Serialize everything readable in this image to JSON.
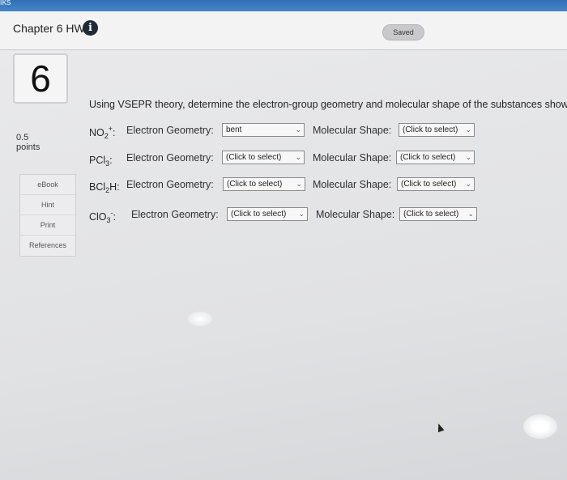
{
  "topbar": {
    "fragment": "iks"
  },
  "header": {
    "title": "Chapter 6 HW",
    "info_icon": "i",
    "status": "Saved"
  },
  "question": {
    "number": "6",
    "points_value": "0.5",
    "points_label": "points",
    "prompt": "Using VSEPR theory, determine the electron-group geometry and molecular shape of the substances shown."
  },
  "sidebar": {
    "links": [
      {
        "label": "eBook"
      },
      {
        "label": "Hint"
      },
      {
        "label": "Print"
      },
      {
        "label": "References"
      }
    ]
  },
  "rows": [
    {
      "species_base": "NO",
      "species_sub": "2",
      "species_sup": "+",
      "suffix": ":",
      "eg_label": "Electron Geometry:",
      "eg_value": "bent",
      "ms_label": "Molecular Shape:",
      "ms_value": "(Click to select)"
    },
    {
      "species_base": "PCl",
      "species_sub": "3",
      "species_sup": "",
      "suffix": ":",
      "eg_label": "Electron Geometry:",
      "eg_value": "(Click to select)",
      "ms_label": "Molecular Shape:",
      "ms_value": "(Click to select)"
    },
    {
      "species_base": "BCl",
      "species_sub": "2",
      "species_sup": "",
      "suffix": "H:",
      "eg_label": "Electron Geometry:",
      "eg_value": "(Click to select)",
      "ms_label": "Molecular Shape:",
      "ms_value": "(Click to select)"
    },
    {
      "species_base": "ClO",
      "species_sub": "3",
      "species_sup": "-",
      "suffix": ":",
      "eg_label": "Electron Geometry:",
      "eg_value": "(Click to select)",
      "ms_label": "Molecular Shape:",
      "ms_value": "(Click to select)"
    }
  ],
  "dropdown_chevron": "⌄",
  "colors": {
    "header_bg": "#f3f3f4",
    "content_bg": "#e5e5e7",
    "topbar": "#2d6fb6"
  }
}
